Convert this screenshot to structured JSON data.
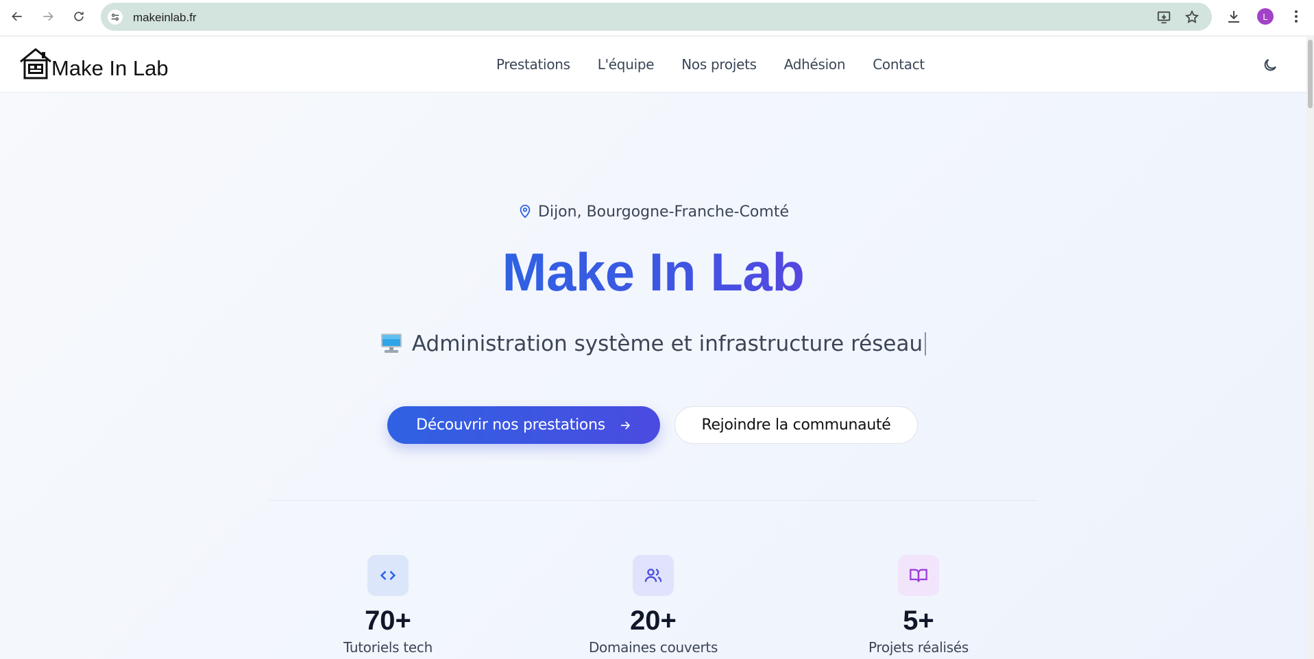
{
  "browser": {
    "url": "makeinlab.fr",
    "profile_initial": "L"
  },
  "header": {
    "logo_text": "Make In Lab",
    "nav": [
      "Prestations",
      "L'équipe",
      "Nos projets",
      "Adhésion",
      "Contact"
    ]
  },
  "hero": {
    "location": "Dijon, Bourgogne-Franche-Comté",
    "title": "Make In Lab",
    "tagline_emoji": "desktop-computer-icon",
    "tagline": "Administration système et infrastructure réseau",
    "cta_primary": "Découvrir nos prestations",
    "cta_secondary": "Rejoindre la communauté"
  },
  "stats": [
    {
      "icon": "code-icon",
      "value": "70+",
      "label": "Tutoriels tech",
      "color": "#2f62e3",
      "bg": "#dce6fb"
    },
    {
      "icon": "users-icon",
      "value": "20+",
      "label": "Domaines couverts",
      "color": "#4a4be0",
      "bg": "#e0e3fb"
    },
    {
      "icon": "book-icon",
      "value": "5+",
      "label": "Projets réalisés",
      "color": "#9b3fd9",
      "bg": "#f1e4fb"
    }
  ],
  "colors": {
    "accent_blue": "#2f62e3",
    "accent_indigo": "#4a4be0",
    "text_dark": "#0f1729",
    "text_muted": "#3a4556"
  }
}
